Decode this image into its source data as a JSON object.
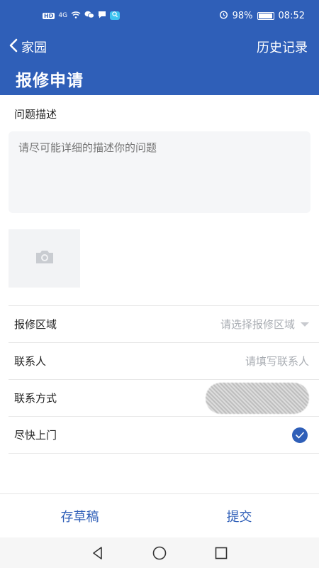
{
  "status_bar": {
    "left_chip": "HD",
    "signal_text": "4G",
    "battery_percent": "98%",
    "battery_level": 0.98,
    "time": "08:52",
    "icons": [
      "hd-icon",
      "signal-icon",
      "wifi-icon",
      "wechat-icon",
      "message-icon",
      "qq-icon",
      "alarm-icon",
      "battery-icon"
    ]
  },
  "nav": {
    "back_label": "家园",
    "history_label": "历史记录"
  },
  "page": {
    "title": "报修申请"
  },
  "form": {
    "description_label": "问题描述",
    "description_placeholder": "请尽可能详细的描述你的问题",
    "photo_icon": "camera-icon",
    "rows": [
      {
        "label": "报修区域",
        "value": "请选择报修区域"
      },
      {
        "label": "联系人",
        "value": "请填写联系人"
      },
      {
        "label": "联系方式",
        "value": ""
      },
      {
        "label": "尽快上门",
        "checked": true
      }
    ]
  },
  "bottom": {
    "draft_label": "存草稿",
    "submit_label": "提交"
  },
  "colors": {
    "primary": "#2f5fb8",
    "placeholder": "#a9adb3",
    "input_bg": "#f5f6f8"
  }
}
